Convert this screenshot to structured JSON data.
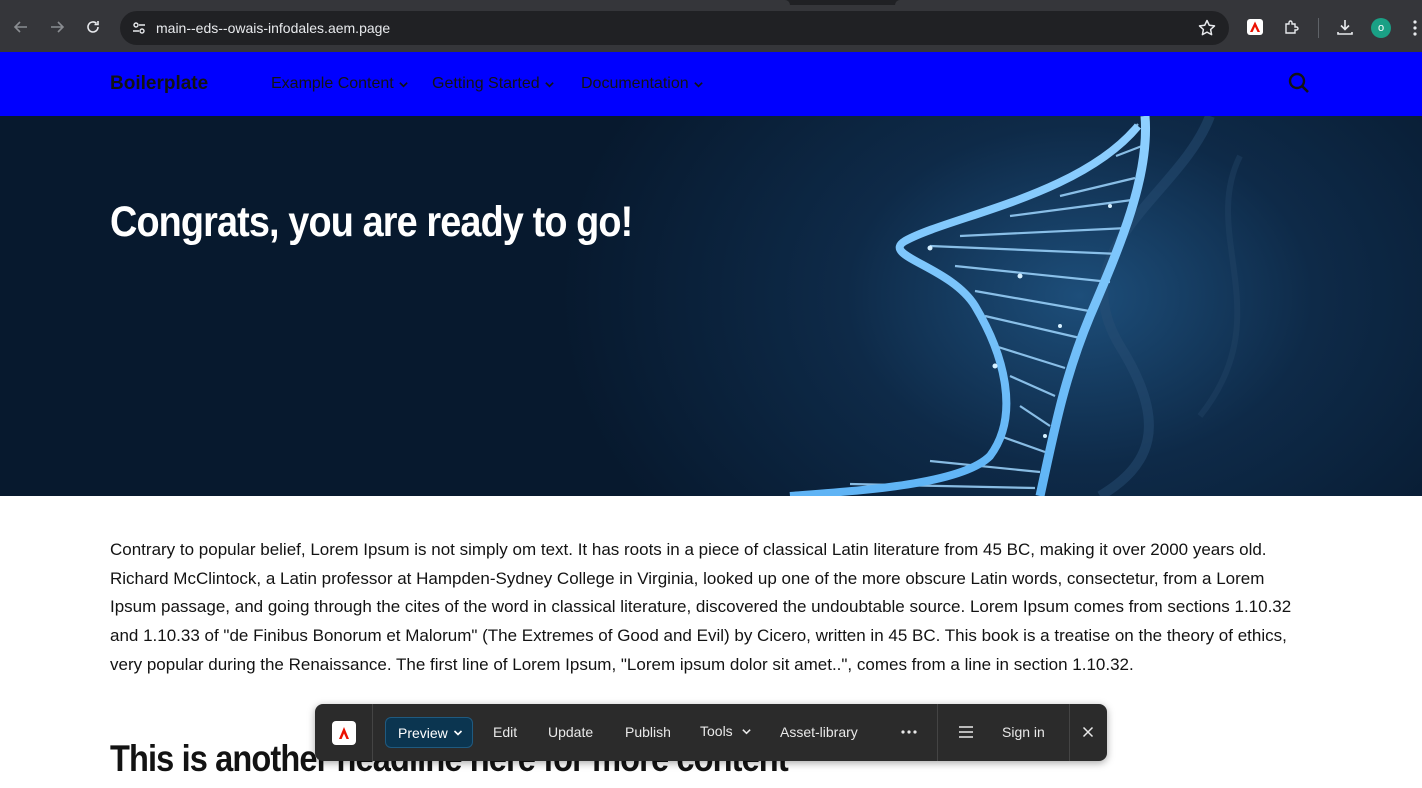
{
  "browser": {
    "url": "main--eds--owais-infodales.aem.page",
    "profile_initial": "o"
  },
  "site": {
    "brand": "Boilerplate",
    "nav": [
      {
        "label": "Example Content"
      },
      {
        "label": "Getting Started"
      },
      {
        "label": "Documentation"
      }
    ]
  },
  "hero": {
    "title": "Congrats, you are ready to go!"
  },
  "content": {
    "paragraph": "Contrary to popular belief, Lorem Ipsum is not simply om text. It has roots in a piece of classical Latin literature from 45 BC, making it over 2000 years old. Richard McClintock, a Latin professor at Hampden-Sydney College in Virginia, looked up one of the more obscure Latin words, consectetur, from a Lorem Ipsum passage, and going through the cites of the word in classical literature, discovered the undoubtable source. Lorem Ipsum comes from sections 1.10.32 and 1.10.33 of \"de Finibus Bonorum et Malorum\" (The Extremes of Good and Evil) by Cicero, written in 45 BC. This book is a treatise on the theory of ethics, very popular during the Renaissance. The first line of Lorem Ipsum, \"Lorem ipsum dolor sit amet..\", comes from a line in section 1.10.32.",
    "heading2": "This is another headline here for more content"
  },
  "sidekick": {
    "preview_label": "Preview",
    "edit_label": "Edit",
    "update_label": "Update",
    "publish_label": "Publish",
    "tools_label": "Tools",
    "asset_library_label": "Asset-library",
    "sign_in_label": "Sign in"
  },
  "colors": {
    "header_bg": "#0000ff",
    "hero_bg": "#07192e",
    "sidekick_bg": "#2b2b2b",
    "preview_bg": "#0b3550",
    "adobe_red": "#eb1000"
  },
  "icons": [
    "back-icon",
    "forward-icon",
    "reload-icon",
    "site-info-icon",
    "star-icon",
    "adobe-extension-icon",
    "puzzle-icon",
    "download-icon",
    "menu-kebab-icon",
    "search-icon",
    "chevron-down-icon",
    "adobe-logo-icon",
    "more-icon",
    "hamburger-icon",
    "close-icon"
  ]
}
